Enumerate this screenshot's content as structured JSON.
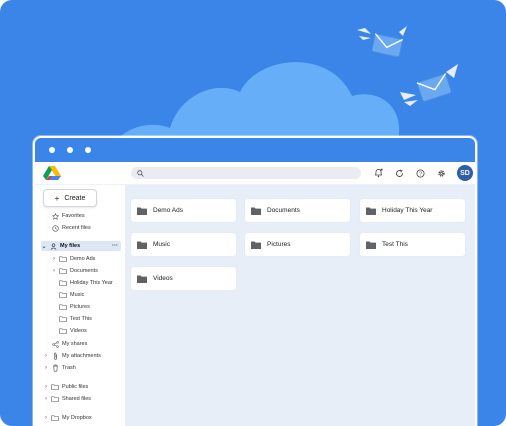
{
  "colors": {
    "background": "#3b84e8",
    "cloud": "#66aef7",
    "accent": "#2e5fa8",
    "main_bg": "#e8eef7"
  },
  "window": {
    "dots": [
      "close",
      "minimize",
      "maximize"
    ]
  },
  "topbar": {
    "logo_icon": "google-drive-icon",
    "search_icon": "search-icon",
    "icons": [
      "bell-icon",
      "sync-icon",
      "help-icon",
      "gear-icon"
    ],
    "avatar": "SD"
  },
  "sidebar": {
    "create_label": "Create",
    "favorites": "Favorites",
    "recent": "Recent files",
    "my_files": "My files",
    "my_files_children": [
      "Demo Ads",
      "Documents",
      "Holiday This Year",
      "Music",
      "Pictures",
      "Test This",
      "Videos"
    ],
    "my_shares": "My shares",
    "my_attachments": "My attachments",
    "trash": "Trash",
    "public_files": "Public files",
    "shared_files": "Shared files",
    "my_dropbox": "My Dropbox"
  },
  "folders": [
    "Demo Ads",
    "Documents",
    "Holiday This Year",
    "Music",
    "Pictures",
    "Test This",
    "Videos"
  ]
}
